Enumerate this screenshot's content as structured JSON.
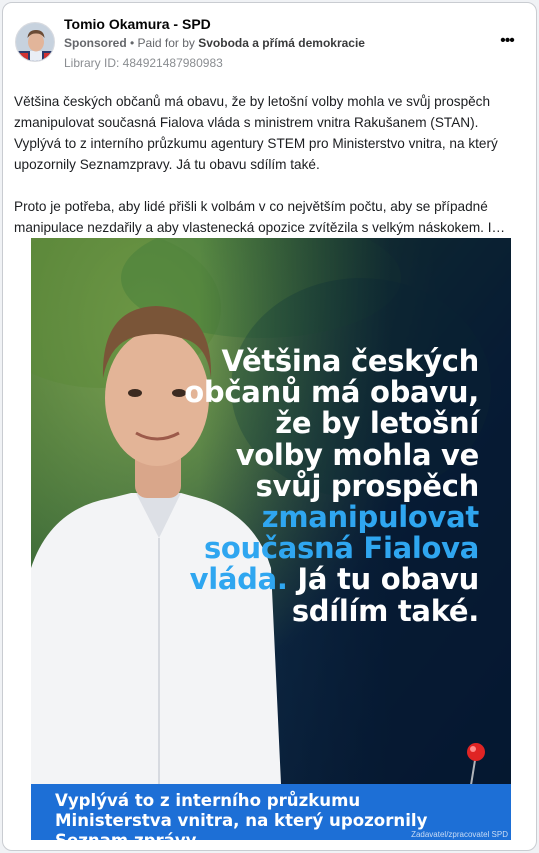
{
  "post": {
    "page_name": "Tomio Okamura - SPD",
    "sponsored_label": "Sponsored",
    "separator": " • ",
    "paid_by_label": "Paid for by ",
    "payer": "Svoboda a přímá demokracie",
    "library_id": "Library ID: 484921487980983",
    "more_icon": "•••",
    "paragraph1": "Většina českých občanů má obavu, že by letošní volby mohla ve svůj prospěch zmanipulovat současná Fialova vláda s ministrem vnitra Rakušanem (STAN). Vyplývá to z interního průzkumu agentury STEM pro Ministerstvo vnitra, na který upozornily Seznamzpravy. Já tu obavu sdílím také.",
    "paragraph2": "Proto je potřeba, aby lidé přišli k volbám v co největším počtu, aby se případné manipulace nezdařily a aby vlastenecká opozice zvítězila s velkým náskokem. I…"
  },
  "creative": {
    "headline_white_1": "Většina českých občanů má obavu, že by letošní volby mohla ve svůj prospěch",
    "headline_blue": "zmanipulovat současná Fialova vláda.",
    "headline_white_2": " Já tu obavu sdílím také.",
    "banner_text": "Vyplývá to z interního průzkumu Ministerstva vnitra, na který upozornily Seznam zprávy",
    "credit": "Zadavatel/zpracovatel SPD"
  },
  "colors": {
    "accent_blue": "#2fa6f0",
    "banner_blue": "#1d6fd6"
  }
}
